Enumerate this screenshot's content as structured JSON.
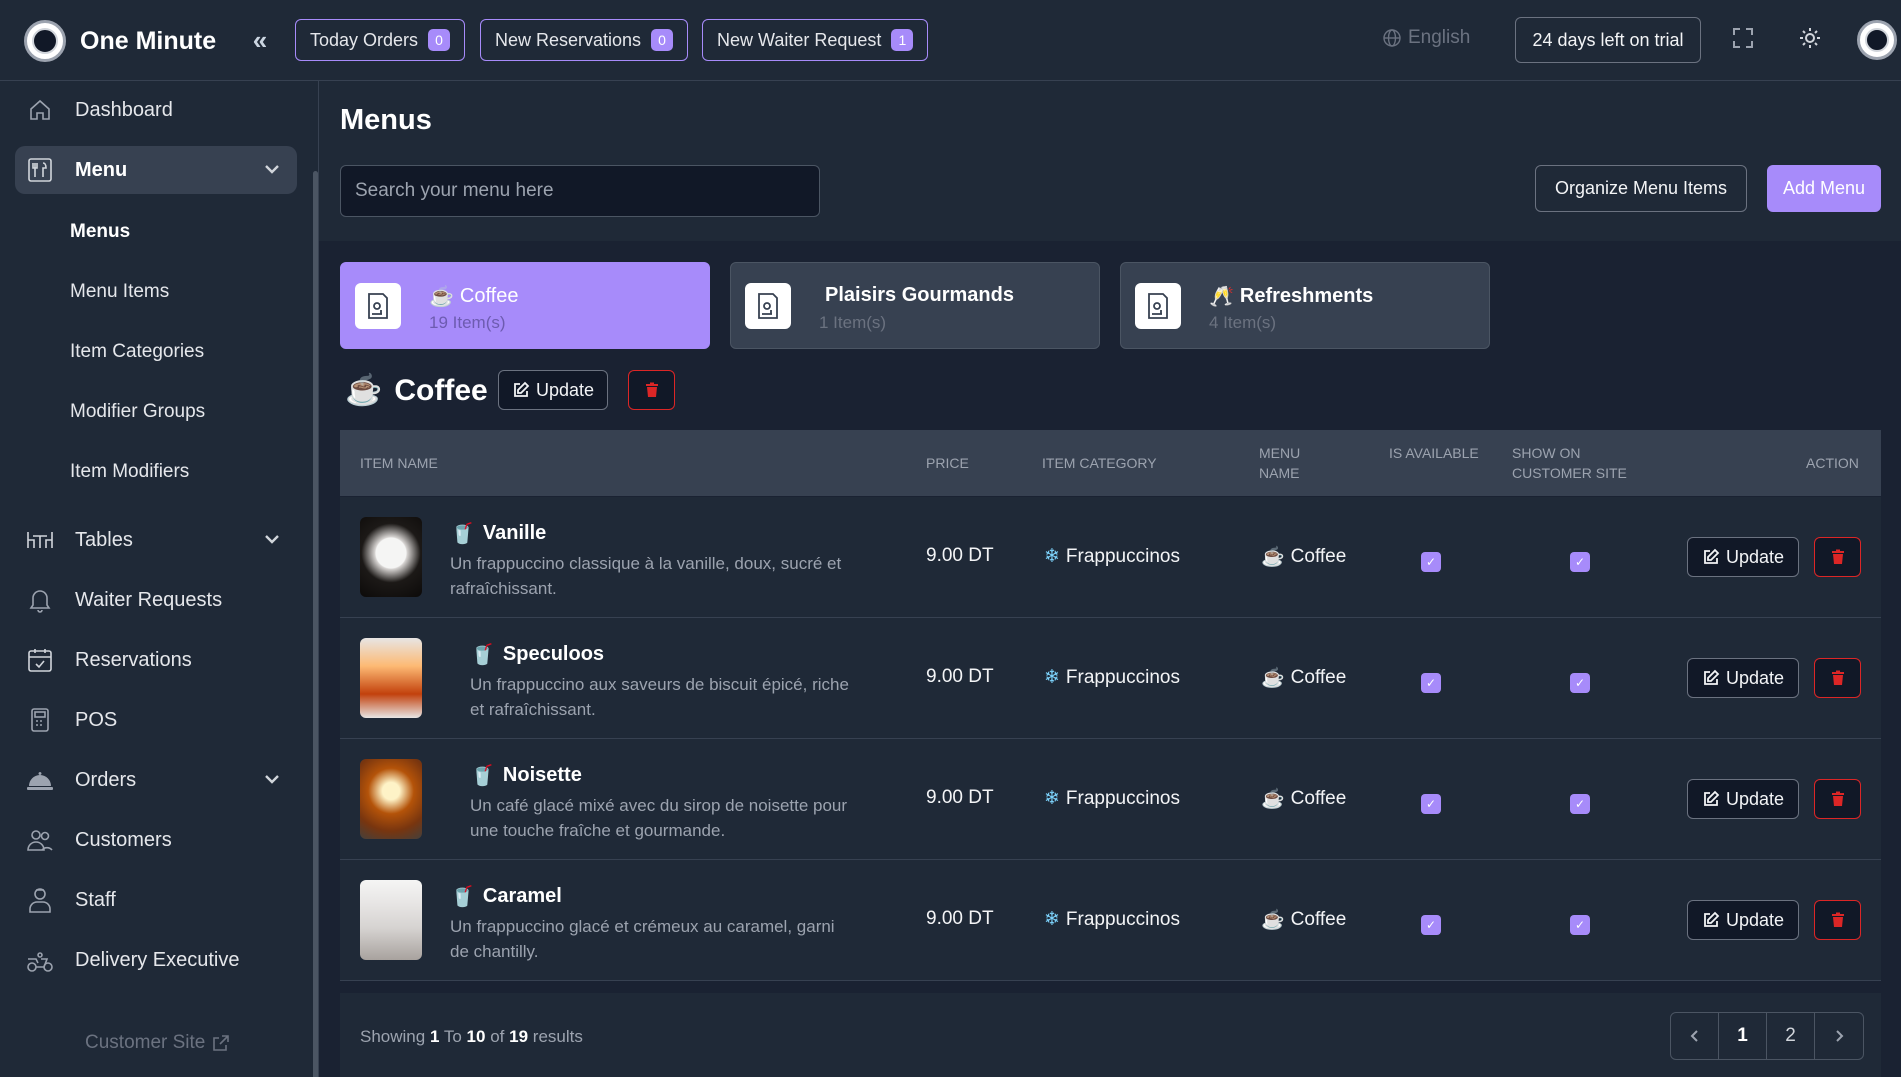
{
  "app": {
    "brand": "One Minute"
  },
  "topbar": {
    "pills": [
      {
        "label": "Today Orders",
        "count": "0"
      },
      {
        "label": "New Reservations",
        "count": "0"
      },
      {
        "label": "New Waiter Request",
        "count": "1"
      }
    ],
    "language": "English",
    "trial": "24 days left on trial"
  },
  "sidebar": {
    "items": [
      {
        "label": "Dashboard",
        "icon": "home-icon"
      },
      {
        "label": "Menu",
        "icon": "menu-icon"
      },
      {
        "label": "Tables",
        "icon": "table-icon"
      },
      {
        "label": "Waiter Requests",
        "icon": "bell-icon"
      },
      {
        "label": "Reservations",
        "icon": "calendar-icon"
      },
      {
        "label": "POS",
        "icon": "pos-icon"
      },
      {
        "label": "Orders",
        "icon": "cloche-icon"
      },
      {
        "label": "Customers",
        "icon": "users-icon"
      },
      {
        "label": "Staff",
        "icon": "staff-icon"
      },
      {
        "label": "Delivery Executive",
        "icon": "scooter-icon"
      }
    ],
    "menu_sub": [
      "Menus",
      "Menu Items",
      "Item Categories",
      "Modifier Groups",
      "Item Modifiers"
    ],
    "customer_site": "Customer Site"
  },
  "main": {
    "title": "Menus",
    "search_placeholder": "Search your menu here",
    "organize_label": "Organize Menu Items",
    "add_label": "Add Menu",
    "menus": [
      {
        "emoji": "☕",
        "name": "Coffee",
        "count": "19 Item(s)"
      },
      {
        "emoji": "",
        "name": "Plaisirs Gourmands",
        "count": "1 Item(s)"
      },
      {
        "emoji": "🥂",
        "name": "Refreshments",
        "count": "4 Item(s)"
      }
    ],
    "section": {
      "emoji": "☕",
      "title": "Coffee",
      "update_label": "Update"
    },
    "columns": [
      "Item Name",
      "Price",
      "Item Category",
      "Menu Name",
      "Is Available",
      "Show On Customer Site",
      "Action"
    ],
    "items": [
      {
        "name": "Vanille",
        "desc": "Un frappuccino classique à la vanille, doux, sucré et rafraîchissant.",
        "price": "9.00 DT",
        "category": "Frappuccinos",
        "menu": "Coffee",
        "available": true,
        "show": true,
        "update": "Update"
      },
      {
        "name": "Speculoos",
        "desc": "Un frappuccino aux saveurs de biscuit épicé, riche et rafraîchissant.",
        "price": "9.00 DT",
        "category": "Frappuccinos",
        "menu": "Coffee",
        "available": true,
        "show": true,
        "update": "Update"
      },
      {
        "name": "Noisette",
        "desc": "Un café glacé mixé avec du sirop de noisette pour une touche fraîche et gourmande.",
        "price": "9.00 DT",
        "category": "Frappuccinos",
        "menu": "Coffee",
        "available": true,
        "show": true,
        "update": "Update"
      },
      {
        "name": "Caramel",
        "desc": "Un frappuccino glacé et crémeux au caramel, garni de chantilly.",
        "price": "9.00 DT",
        "category": "Frappuccinos",
        "menu": "Coffee",
        "available": true,
        "show": true,
        "update": "Update"
      }
    ],
    "pagination": {
      "showing": "Showing",
      "from": "1",
      "to_word": "To",
      "to": "10",
      "of_word": "of",
      "total": "19",
      "results": "results",
      "pages": [
        "1",
        "2"
      ]
    }
  },
  "colors": {
    "accent": "#a78bfa",
    "danger": "#dc2626",
    "bg": "#1f2937"
  }
}
